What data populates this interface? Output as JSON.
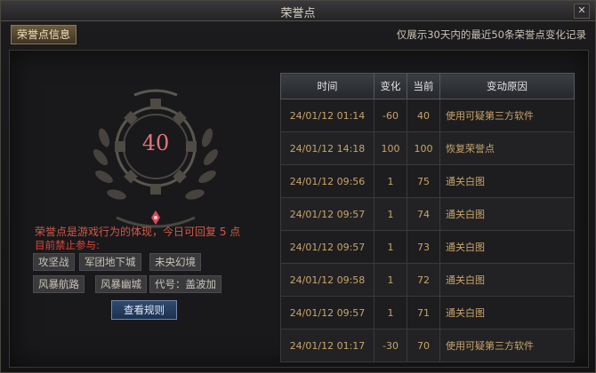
{
  "window": {
    "title": "荣誉点",
    "close_glyph": "✕"
  },
  "tab_label": "荣誉点信息",
  "notice": "仅展示30天内的最近50条荣誉点变化记录",
  "honor": {
    "score": "40",
    "description": "荣誉点是游戏行为的体现，今日可回复 5 点",
    "forbidden_title": "目前禁止参与:",
    "restricted": [
      "攻坚战",
      "军团地下城",
      "未央幻境",
      "风暴航路",
      "风暴幽城",
      "代号：盖波加"
    ]
  },
  "rules_button": "查看规则",
  "table": {
    "headers": [
      "时间",
      "变化",
      "当前",
      "变动原因"
    ],
    "rows": [
      {
        "time": "24/01/12 01:14",
        "change": "-60",
        "current": "40",
        "reason": "使用可疑第三方软件"
      },
      {
        "time": "24/01/12 14:18",
        "change": "100",
        "current": "100",
        "reason": "恢复荣誉点"
      },
      {
        "time": "24/01/12 09:56",
        "change": "1",
        "current": "75",
        "reason": "通关白图"
      },
      {
        "time": "24/01/12 09:57",
        "change": "1",
        "current": "74",
        "reason": "通关白图"
      },
      {
        "time": "24/01/12 09:57",
        "change": "1",
        "current": "73",
        "reason": "通关白图"
      },
      {
        "time": "24/01/12 09:58",
        "change": "1",
        "current": "72",
        "reason": "通关白图"
      },
      {
        "time": "24/01/12 09:57",
        "change": "1",
        "current": "71",
        "reason": "通关白图"
      },
      {
        "time": "24/01/12 01:17",
        "change": "-30",
        "current": "70",
        "reason": "使用可疑第三方软件"
      }
    ]
  },
  "colors": {
    "accent": "#e5727a",
    "warning": "#e0453a",
    "gold": "#c9a46a"
  }
}
